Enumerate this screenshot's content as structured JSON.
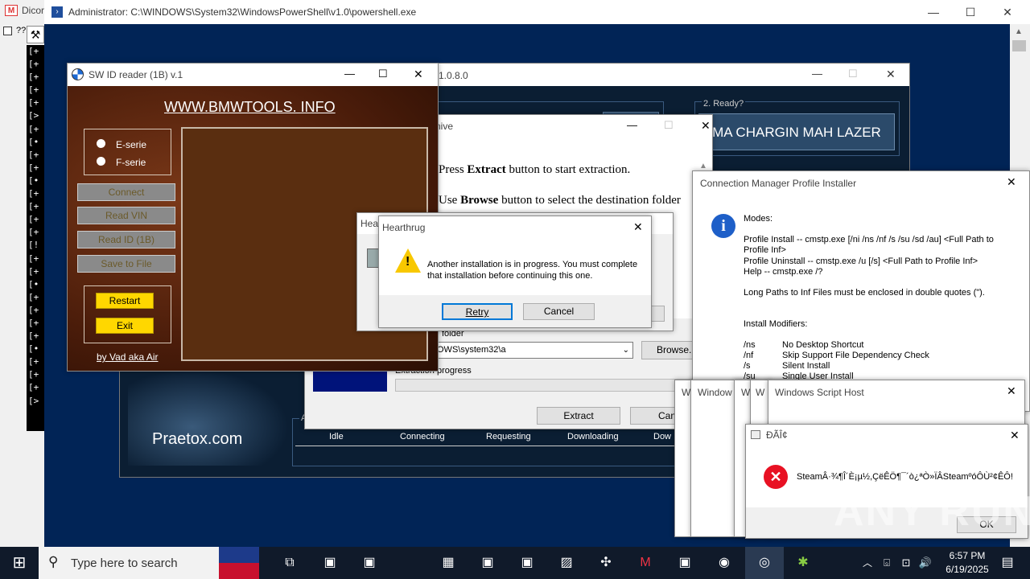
{
  "background_app": {
    "title": "Dicor",
    "checkbox_label": "??",
    "console_lines": [
      "[+",
      "[+",
      "[+",
      "[+",
      "[+",
      "[>",
      "[+",
      "[•",
      "[+",
      "[+",
      "[•",
      "[+",
      "[+",
      "[+",
      "[+",
      "[!",
      "[+",
      "[+",
      "[•",
      "[+",
      "[+",
      "[+",
      "[+",
      "[•",
      "[+",
      "[+",
      "[+",
      "[>"
    ]
  },
  "powershell": {
    "title": "Administrator: C:\\WINDOWS\\System32\\WindowsPowerShell\\v1.0\\powershell.exe"
  },
  "lazer_window": {
    "title_fragment": "1.0.8.0",
    "ready_label": "2. Ready?",
    "ready_button": "MA CHARGIN MAH LAZER",
    "site_logo": "Praetox.com",
    "table_headers": [
      "Idle",
      "Connecting",
      "Requesting",
      "Downloading",
      "Dow"
    ],
    "group_letter": "A"
  },
  "sw_reader": {
    "title": "SW ID reader (1B)",
    "version": "v.1",
    "website": "WWW.BMWTOOLS. INFO",
    "radio_e": "E-serie",
    "radio_f": "F-serie",
    "btn_connect": "Connect",
    "btn_read_vin": "Read VIN",
    "btn_read_id": "Read ID (1B)",
    "btn_save": "Save to File",
    "btn_restart": "Restart",
    "btn_exit": "Exit",
    "credit": "by Vad aka Air"
  },
  "archive": {
    "title_fragment": "hive",
    "line1_pre": "Press ",
    "line1_bold": "Extract",
    "line1_post": " button to start extraction.",
    "line2_pre": "Use ",
    "line2_bold": "Browse",
    "line2_post": " button to select the destination folder",
    "folder_label": "folder",
    "folder_value": "OWS\\system32\\a",
    "browse_label": "Browse...",
    "progress_label": "Extraction progress",
    "extract_label": "Extract",
    "cancel_label": "Cance"
  },
  "hearthrug_back": {
    "title": "Hear"
  },
  "hearthrug": {
    "title": "Hearthrug",
    "message": "Another installation is in progress. You must complete that installation before continuing this one.",
    "retry_label": "Retry",
    "cancel_label": "Cancel"
  },
  "cm_installer": {
    "title": "Connection Manager Profile Installer",
    "modes_label": "Modes:",
    "lines": [
      "Profile Install -- cmstp.exe [/ni /ns /nf /s /su /sd /au] <Full Path to Profile Inf>",
      "Profile Uninstall -- cmstp.exe /u [/s] <Full Path to Profile Inf>",
      "Help -- cmstp.exe /?"
    ],
    "long_paths": "Long Paths to Inf Files must be enclosed in double quotes (\").",
    "modifiers_label": "Install Modifiers:",
    "modifiers": [
      {
        "flag": "/ns",
        "desc": "No Desktop Shortcut"
      },
      {
        "flag": "/nf",
        "desc": "Skip Support File Dependency Check"
      },
      {
        "flag": "/s",
        "desc": "Silent Install"
      },
      {
        "flag": "/su",
        "desc": "Single User Install"
      }
    ]
  },
  "wsh_stack": {
    "tab1": "W",
    "tab2": "Window",
    "tab3": "W",
    "tab4": "W",
    "main_title": "Windows Script Host"
  },
  "steam_error": {
    "title": "ÐÃÎ¢",
    "message": "SteamÂ·¾¶Î´È¡µ½,ÇëÊÖ¶¯´ò¿ªÒ»ÏÂSteamºóÔÙ²¢ÊÔ!",
    "ok_label": "OK"
  },
  "watermark": "ANY RUN",
  "taskbar": {
    "search_placeholder": "Type here to search",
    "time": "6:57 PM",
    "date": "6/19/2025"
  },
  "colors": {
    "desktop_blue": "#0a2a66",
    "leather": "#5a2a14",
    "yellow_button": "#ffd700",
    "taskbar": "#101a2a"
  }
}
